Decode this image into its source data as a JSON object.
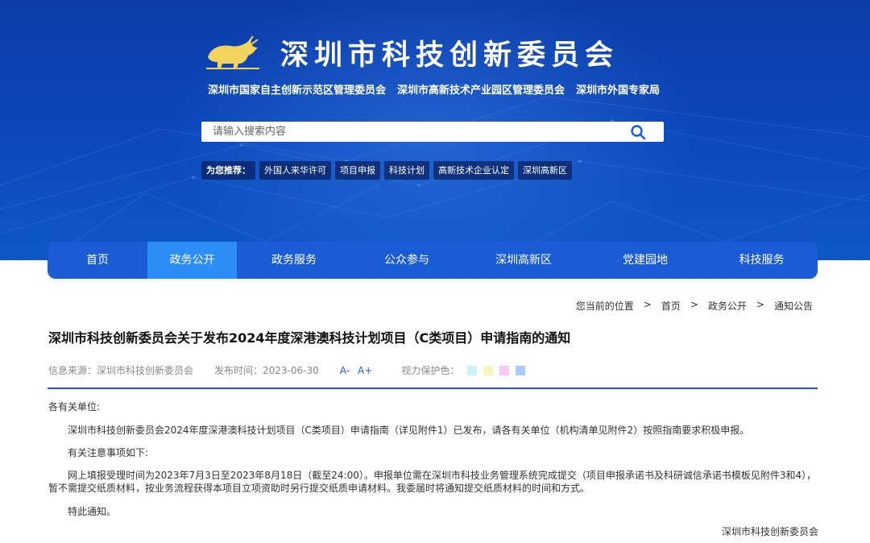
{
  "header": {
    "site_title": "深圳市科技创新委员会",
    "sub_orgs": [
      "深圳市国家自主创新示范区管理委员会",
      "深圳市高新技术产业园区管理委员会",
      "深圳市外国专家局"
    ]
  },
  "search": {
    "placeholder": "请输入搜索内容"
  },
  "hot": {
    "label": "为您推荐：",
    "tags": [
      "外国人来华许可",
      "项目申报",
      "科技计划",
      "高新技术企业认定",
      "深圳高新区"
    ]
  },
  "nav": {
    "items": [
      "首页",
      "政务公开",
      "政务服务",
      "公众参与",
      "深圳高新区",
      "党建园地",
      "科技服务"
    ],
    "active_index": 1
  },
  "breadcrumb": {
    "prefix": "您当前的位置",
    "items": [
      "首页",
      "政务公开",
      "通知公告"
    ]
  },
  "article": {
    "title": "深圳市科技创新委员会关于发布2024年度深港澳科技计划项目（C类项目）申请指南的通知",
    "source_label": "信息来源：深圳市科技创新委员会",
    "date_label": "发布时间：2023-06-30",
    "font_smaller": "A-",
    "font_larger": "A+",
    "eye_care_label": "视力保护色：",
    "swatch_colors": [
      "#c8f4f8",
      "#f8f4c0",
      "#f8c8f0",
      "#a8ccf8"
    ],
    "salutation": "各有关单位:",
    "para1": "深圳市科技创新委员会2024年度深港澳科技计划项目（C类项目）申请指南（详见附件1）已发布，请各有关单位（机构清单见附件2）按照指南要求积极申报。",
    "para2": "有关注意事项如下:",
    "para3_line1": "网上填报受理时间为2023年7月3日至2023年8月18日（截至24:00）。申报单位需在深圳市科技业务管理系统完成提交（项目申报承诺书及科研诚信承诺书模板见附件3和4），",
    "para3_line2": "暂不需提交纸质材料，按业务流程获得本项目立项资助时另行提交纸质申请材料。我委届时将通知提交纸质材料的时间和方式。",
    "para4": "特此通知。",
    "signature": "深圳市科技创新委员会"
  },
  "colors": {
    "nav_bg": "#1a5cd6",
    "nav_active": "#2b8ff7",
    "divider": "#1a5cd6",
    "accent_link": "#2260d6"
  }
}
